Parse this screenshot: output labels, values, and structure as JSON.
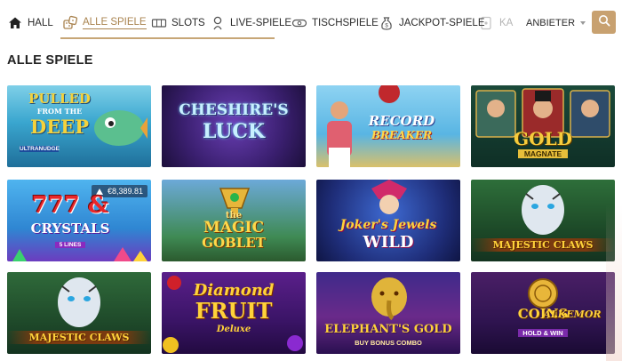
{
  "nav": {
    "items": [
      {
        "key": "hall",
        "label": "HALL",
        "icon": "home-icon"
      },
      {
        "key": "alle",
        "label": "ALLE SPIELE",
        "icon": "dice-icon",
        "active": true
      },
      {
        "key": "slots",
        "label": "SLOTS",
        "icon": "slot-machine-icon"
      },
      {
        "key": "live",
        "label": "LIVE-SPIELE",
        "icon": "live-dealer-icon"
      },
      {
        "key": "tisch",
        "label": "TISCHSPIELE",
        "icon": "chip-icon"
      },
      {
        "key": "jackpot",
        "label": "JACKPOT-SPIELE",
        "icon": "money-bag-icon"
      },
      {
        "key": "ka",
        "label": "KA",
        "icon": "card-icon",
        "faded": true
      }
    ],
    "provider_label": "ANBIETER",
    "accent": "#a9834f",
    "search_icon": "search-icon"
  },
  "section": {
    "title": "ALLE SPIELE"
  },
  "games": [
    {
      "title": "PULLED",
      "title2": "FROM THE",
      "title3": "DEEP",
      "sub": "ULTRANUDGE"
    },
    {
      "title": "CHESHIRE'S",
      "title2": "LUCK"
    },
    {
      "title": "RECORD",
      "title2": "BREAKER"
    },
    {
      "title": "GOLD",
      "title2": "MAGNATE"
    },
    {
      "title": "777 &",
      "title2": "CRYSTALS",
      "sub": "5 LINES",
      "jackpot": "€8,389.81"
    },
    {
      "title": "the",
      "title2": "MAGIC",
      "title3": "GOBLET"
    },
    {
      "title": "Joker's Jewels",
      "title2": "WILD"
    },
    {
      "title": "MAJESTIC CLAWS"
    },
    {
      "title": "MAJESTIC CLAWS"
    },
    {
      "title": "Diamond",
      "title2": "FRUIT",
      "title3": "Deluxe"
    },
    {
      "title": "ELEPHANT'S GOLD",
      "sub": "BUY BONUS COMBO"
    },
    {
      "title": "COINS",
      "title2": "ALKEMOR",
      "sub": "HOLD & WIN"
    }
  ]
}
